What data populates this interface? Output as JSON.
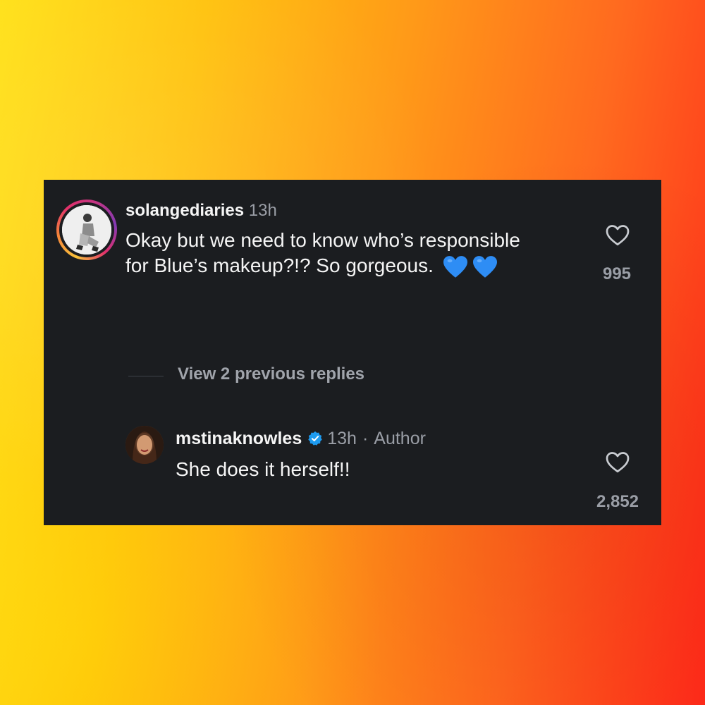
{
  "comment": {
    "username": "solangediaries",
    "time": "13h",
    "text": "Okay but we need to know who’s responsible for Blue’s makeup?!? So gorgeous.",
    "emoji": [
      "blue-heart",
      "blue-heart"
    ],
    "likes": "995"
  },
  "replies_toggle": {
    "label": "View 2 previous replies"
  },
  "reply": {
    "username": "mstinaknowles",
    "verified": true,
    "time": "13h",
    "separator": "·",
    "role": "Author",
    "text": "She does it herself!!",
    "likes": "2,852"
  },
  "colors": {
    "card_bg": "#1b1d20",
    "text_primary": "#f5f5f5",
    "text_secondary": "#9a9ea6",
    "verified_blue": "#1d9bf0",
    "emoji_blue": "#2e8df5"
  }
}
